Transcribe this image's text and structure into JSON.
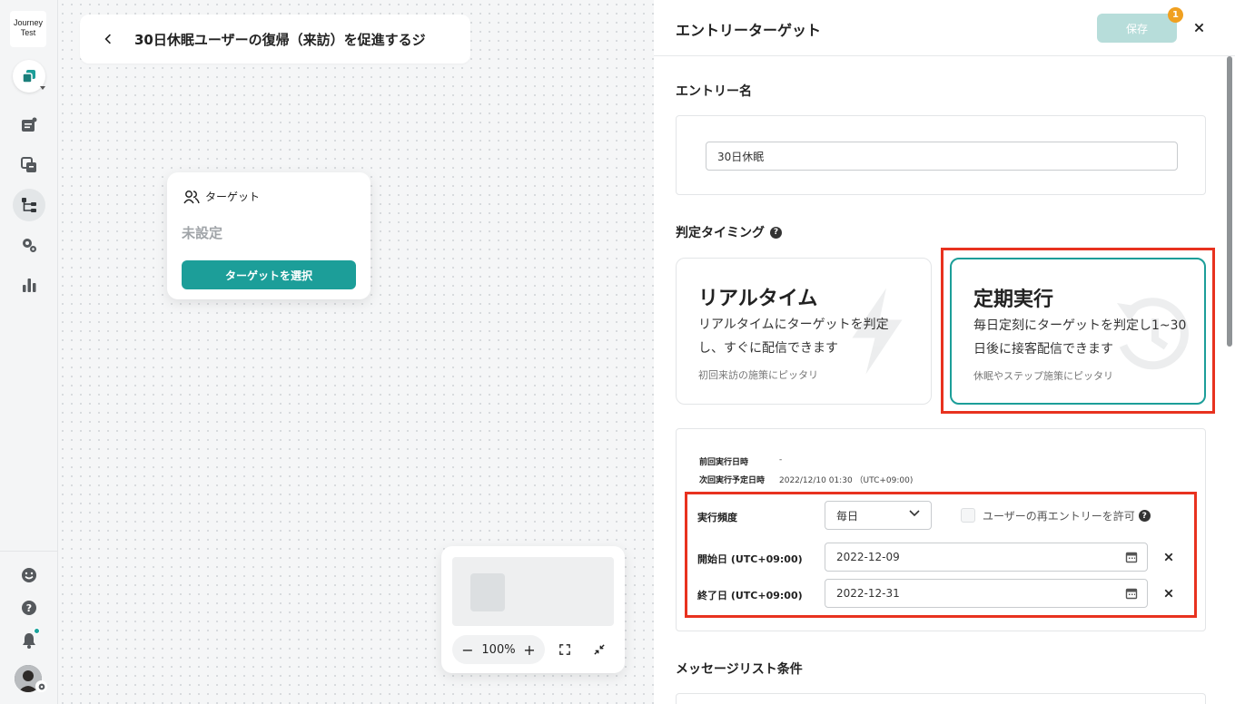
{
  "sidebar": {
    "logo_line1": "Journey",
    "logo_line2": "Test"
  },
  "canvas": {
    "title": "30日休眠ユーザーの復帰（来訪）を促進するジ",
    "node": {
      "label": "ターゲット",
      "status": "未設定",
      "button": "ターゲットを選択"
    },
    "zoom": "100%",
    "zoom_out": "−",
    "zoom_in": "+"
  },
  "panel": {
    "title": "エントリーターゲット",
    "save_label": "保存",
    "save_badge": "1",
    "entry_name_label": "エントリー名",
    "entry_name_value": "30日休眠",
    "timing_label": "判定タイミング",
    "cards": [
      {
        "title": "リアルタイム",
        "desc": "リアルタイムにターゲットを判定し、すぐに配信できます",
        "note": "初回来訪の施策にピッタリ"
      },
      {
        "title": "定期実行",
        "desc": "毎日定刻にターゲットを判定し1~30日後に接客配信できます",
        "note": "休眠やステップ施策にピッタリ"
      }
    ],
    "last_run_label": "前回実行日時",
    "last_run_value": "-",
    "next_run_label": "次回実行予定日時",
    "next_run_value": "2022/12/10 01:30 （UTC+09:00)",
    "frequency_label": "実行頻度",
    "frequency_value": "毎日",
    "reentry_label": "ユーザーの再エントリーを許可",
    "start_label": "開始日 (UTC+09:00)",
    "start_value": "2022-12-09",
    "end_label": "終了日 (UTC+09:00)",
    "end_value": "2022-12-31",
    "message_list_label": "メッセージリスト条件"
  },
  "colors": {
    "accent": "#1c9e99",
    "highlight": "#e8321f",
    "badge": "#f0a020"
  }
}
